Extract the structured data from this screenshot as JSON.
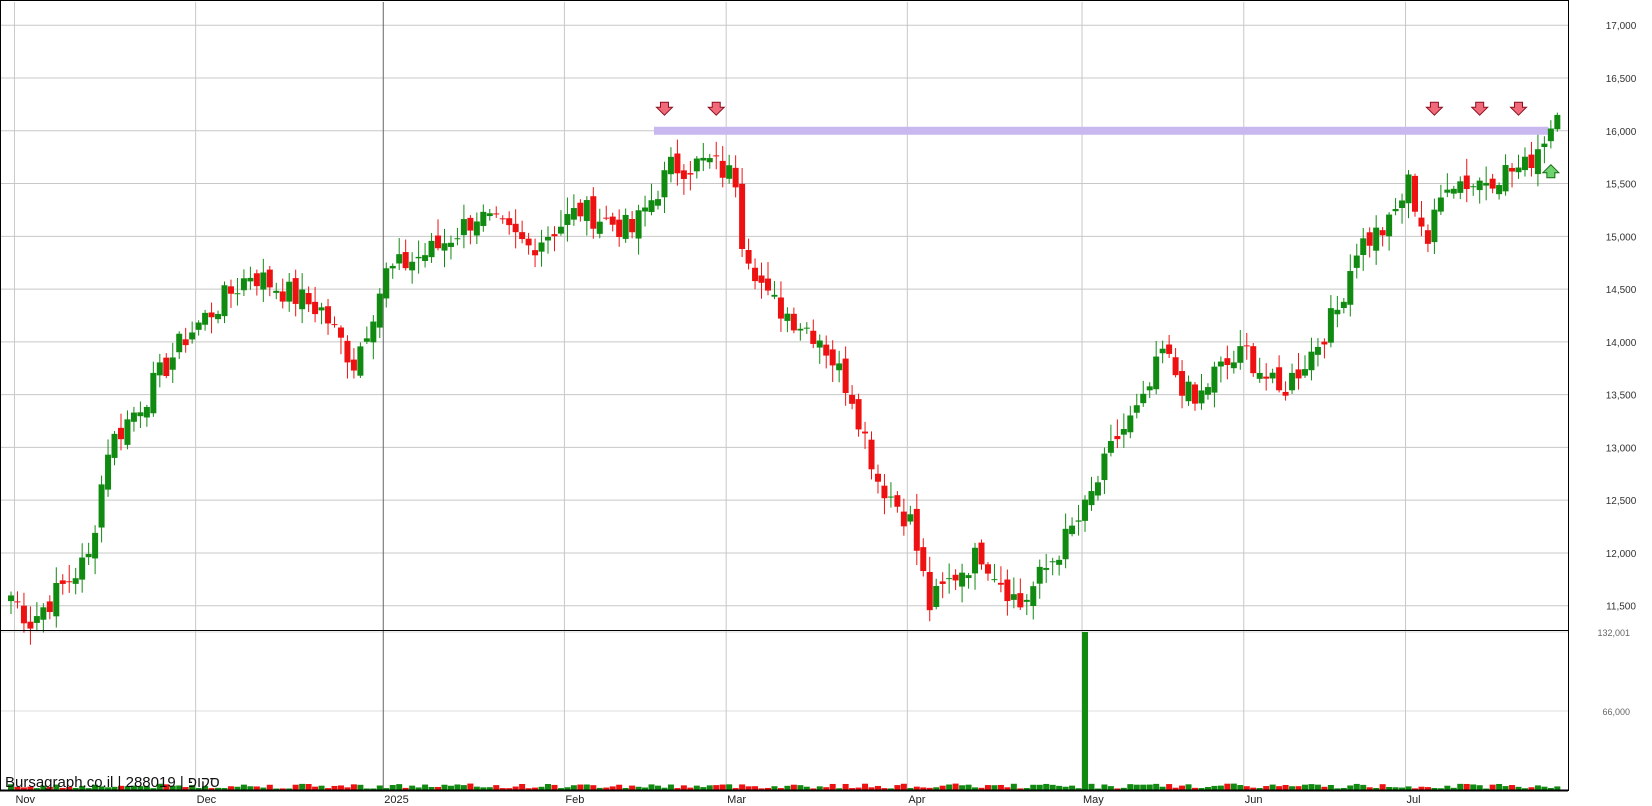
{
  "watermark": "Bursagraph.co.il | 288019 | סקופ",
  "colors": {
    "up": "#118a11",
    "down": "#ee1111",
    "resistance": "#c9b8f0",
    "grid": "#c8c8c8",
    "axis": "#000000"
  },
  "chart_data": {
    "type": "candlestick",
    "price_axis": {
      "ticks": [
        "11,500",
        "12,000",
        "12,500",
        "13,000",
        "13,500",
        "14,000",
        "14,500",
        "15,000",
        "15,500",
        "16,000",
        "16,500",
        "17,000"
      ],
      "values": [
        11500,
        12000,
        12500,
        13000,
        13500,
        14000,
        14500,
        15000,
        15500,
        16000,
        16500,
        17000
      ],
      "ylim": [
        11270,
        17220
      ],
      "position": "right"
    },
    "volume_axis": {
      "ticks": [
        "66,000",
        "132,001"
      ],
      "values": [
        66000,
        132001
      ],
      "ylim": [
        0,
        132001
      ]
    },
    "x_axis": {
      "labels": [
        "Nov",
        "Dec",
        "2025",
        "Feb",
        "Mar",
        "Apr",
        "May",
        "Jun",
        "Jul"
      ],
      "label_index": [
        1,
        29,
        58,
        86,
        111,
        139,
        166,
        191,
        216
      ],
      "strong_index": [
        58
      ]
    },
    "resistance_line": {
      "price": 16000,
      "from_index": 100,
      "to_index": 237
    },
    "down_arrows": [
      {
        "index": 101,
        "price": 16100
      },
      {
        "index": 109,
        "price": 16100
      },
      {
        "index": 220,
        "price": 16100
      },
      {
        "index": 227,
        "price": 16100
      },
      {
        "index": 233,
        "price": 16100
      }
    ],
    "up_arrows": [
      {
        "index": 238,
        "price": 15650
      }
    ],
    "volume_spike": {
      "index": 166,
      "value": 132001
    },
    "series_params": {
      "count": 240,
      "start_close": 11600,
      "seed": 7,
      "anchors": [
        [
          0,
          11600
        ],
        [
          3,
          11350
        ],
        [
          12,
          11950
        ],
        [
          15,
          13000
        ],
        [
          21,
          13500
        ],
        [
          27,
          14050
        ],
        [
          37,
          14650
        ],
        [
          48,
          14300
        ],
        [
          53,
          13800
        ],
        [
          58,
          14650
        ],
        [
          66,
          14900
        ],
        [
          72,
          15200
        ],
        [
          80,
          14900
        ],
        [
          88,
          15250
        ],
        [
          96,
          15050
        ],
        [
          102,
          15650
        ],
        [
          108,
          15700
        ],
        [
          112,
          15550
        ],
        [
          113,
          15000
        ],
        [
          117,
          14400
        ],
        [
          125,
          14050
        ],
        [
          130,
          13500
        ],
        [
          134,
          12700
        ],
        [
          139,
          12300
        ],
        [
          142,
          11500
        ],
        [
          146,
          11800
        ],
        [
          150,
          12000
        ],
        [
          156,
          11500
        ],
        [
          160,
          11850
        ],
        [
          166,
          12400
        ],
        [
          171,
          13100
        ],
        [
          175,
          13400
        ],
        [
          178,
          13900
        ],
        [
          183,
          13400
        ],
        [
          186,
          13700
        ],
        [
          191,
          13900
        ],
        [
          196,
          13500
        ],
        [
          201,
          13900
        ],
        [
          205,
          14300
        ],
        [
          208,
          14900
        ],
        [
          213,
          15100
        ],
        [
          216,
          15500
        ],
        [
          219,
          14950
        ],
        [
          222,
          15550
        ],
        [
          226,
          15500
        ],
        [
          230,
          15600
        ],
        [
          234,
          15650
        ],
        [
          236,
          15850
        ],
        [
          239,
          16150
        ]
      ]
    }
  }
}
